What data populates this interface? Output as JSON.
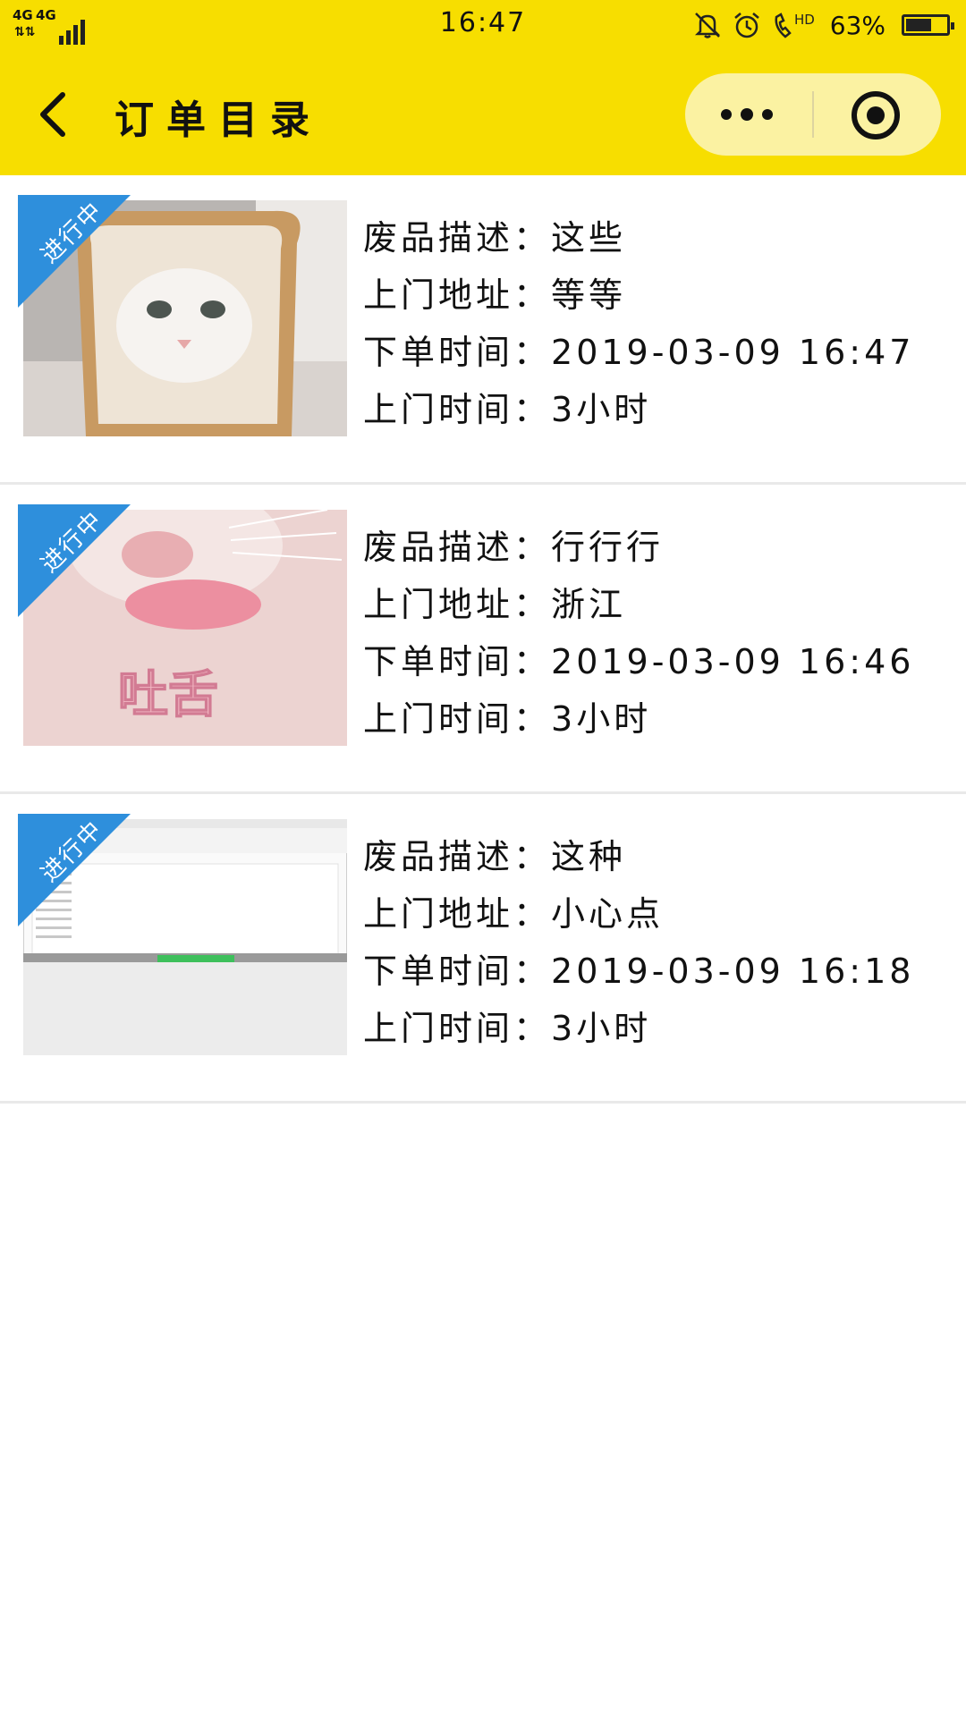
{
  "status_bar": {
    "network_1": "4G",
    "network_2": "4G",
    "time": "16:47",
    "battery_percent": "63%",
    "battery_level": 0.63,
    "hd_label": "HD"
  },
  "nav": {
    "title": "订单目录"
  },
  "orders": [
    {
      "status": "进行中",
      "thumb_caption": "",
      "desc_label": "废品描述：",
      "desc": "这些",
      "addr_label": "上门地址：",
      "addr": "等等",
      "order_time_label": "下单时间：",
      "order_time": "2019-03-09 16:47",
      "visit_label": "上门时间：",
      "visit": "3小时"
    },
    {
      "status": "进行中",
      "thumb_caption": "吐舌",
      "desc_label": "废品描述：",
      "desc": "行行行",
      "addr_label": "上门地址：",
      "addr": "浙江",
      "order_time_label": "下单时间：",
      "order_time": "2019-03-09 16:46",
      "visit_label": "上门时间：",
      "visit": "3小时"
    },
    {
      "status": "进行中",
      "thumb_caption": "",
      "desc_label": "废品描述：",
      "desc": "这种",
      "addr_label": "上门地址：",
      "addr": "小心点",
      "order_time_label": "下单时间：",
      "order_time": "2019-03-09 16:18",
      "visit_label": "上门时间：",
      "visit": "3小时"
    }
  ],
  "colors": {
    "header": "#f7de00",
    "ribbon": "#2e8fdc"
  }
}
